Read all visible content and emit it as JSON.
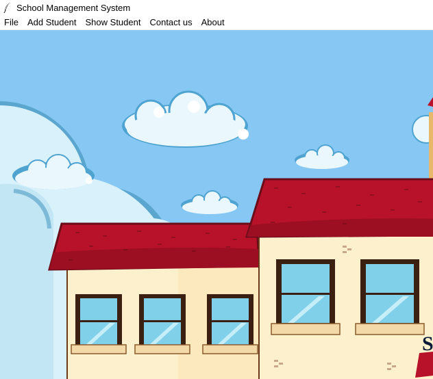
{
  "window": {
    "title": "School Management System",
    "icon": "feather-icon"
  },
  "menu": {
    "items": [
      {
        "id": "file",
        "label": "File"
      },
      {
        "id": "add-student",
        "label": "Add Student"
      },
      {
        "id": "show-student",
        "label": "Show Student"
      },
      {
        "id": "contact-us",
        "label": "Contact us"
      },
      {
        "id": "about",
        "label": "About"
      }
    ]
  },
  "background": {
    "sky_color": "#85c7f2",
    "roof_color": "#b8122a",
    "wall_color": "#fdf0cc",
    "window_glass_color": "#7fd0e8"
  }
}
